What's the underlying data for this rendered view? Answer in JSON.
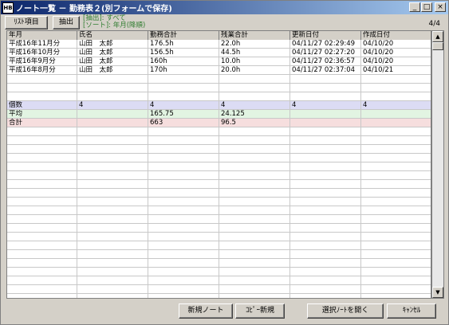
{
  "window": {
    "title": "ノート一覧 － 勤務表２(別フォームで保存)",
    "icon_text": "HB",
    "minimize": "_",
    "maximize": "□",
    "close": "×"
  },
  "toolbar": {
    "list_items_label": "ﾘｽﾄ項目",
    "extract_label": "抽出",
    "filter_text": "[抽出]: すべて",
    "sort_text": "[ソート]: 年月(降順)",
    "record_count": "4/4"
  },
  "grid": {
    "headers": [
      "年月",
      "氏名",
      "勤務合計",
      "残業合計",
      "更新日付",
      "作成日付"
    ],
    "rows": [
      [
        "平成16年11月分",
        "山田　太郎",
        "176.5h",
        "22.0h",
        "04/11/27 02:29:49",
        "04/10/20"
      ],
      [
        "平成16年10月分",
        "山田　太郎",
        "156.5h",
        "44.5h",
        "04/11/27 02:27:20",
        "04/10/20"
      ],
      [
        "平成16年9月分",
        "山田　太郎",
        "160h",
        "10.0h",
        "04/11/27 02:36:57",
        "04/10/20"
      ],
      [
        "平成16年8月分",
        "山田　太郎",
        "170h",
        "20.0h",
        "04/11/27 02:37:04",
        "04/10/21"
      ]
    ],
    "summary": {
      "count": [
        "個数",
        "4",
        "4",
        "4",
        "4",
        "4"
      ],
      "average": [
        "平均",
        "",
        "165.75",
        "24.125",
        "",
        ""
      ],
      "total": [
        "合計",
        "",
        "663",
        "96.5",
        "",
        ""
      ]
    },
    "summary_colors": {
      "count": "#dcdcf4",
      "average": "#e2f4e2",
      "total": "#f6dede"
    }
  },
  "scrollbar": {
    "up": "▲",
    "down": "▼"
  },
  "footer": {
    "new_note": "新規ノート",
    "copy_new": "ｺﾋﾟｰ新規",
    "open_selected": "選択ﾉｰﾄを開く",
    "cancel": "ｷｬﾝｾﾙ"
  }
}
